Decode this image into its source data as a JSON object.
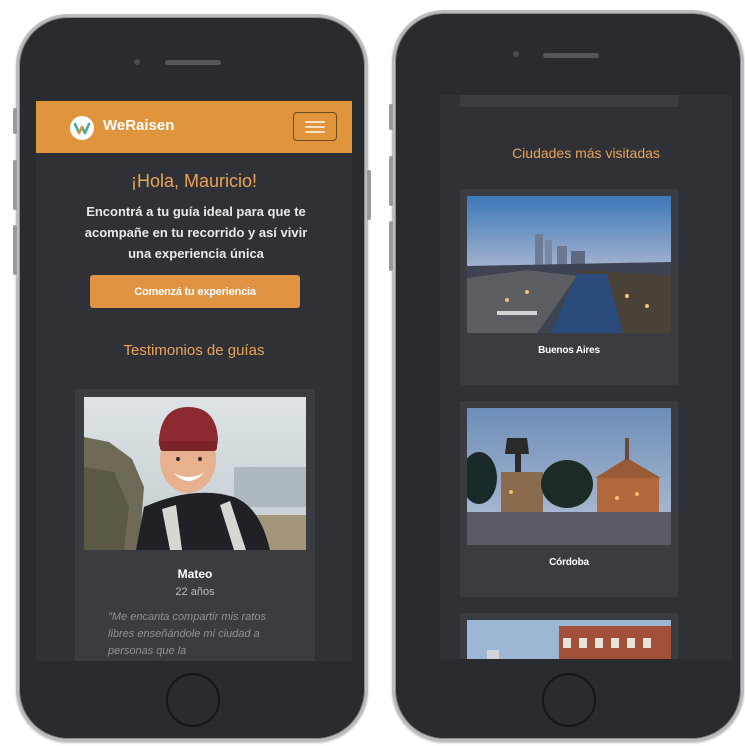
{
  "left_screen": {
    "app_name": "WeRaisen",
    "greeting": "¡Hola, Mauricio!",
    "intro": "Encontrá a tu guía ideal para que te acompañe en tu recorrido y así vivir una experiencia única",
    "cta_label": "Comenzá tu experiencia",
    "testimonials_title": "Testimonios de guías",
    "testimonial": {
      "name": "Mateo",
      "age": "22 años",
      "quote": "\"Me encanta compartir mis ratos libres enseñándole mi ciudad a personas que la"
    }
  },
  "right_screen": {
    "cities_title": "Ciudades más visitadas",
    "cities": [
      {
        "name": "Buenos Aires"
      },
      {
        "name": "Córdoba"
      }
    ]
  },
  "icons": {
    "logo": "weraisen-logo-icon",
    "menu": "hamburger-menu-icon"
  },
  "colors": {
    "accent": "#e0953d",
    "accent_text": "#e9a458",
    "background": "#2f3136",
    "card": "#3a3c42"
  }
}
